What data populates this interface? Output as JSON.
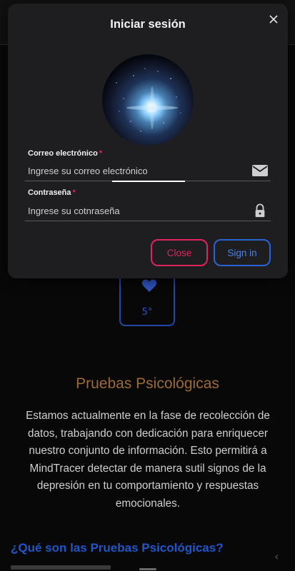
{
  "background": {
    "heart_card": {
      "value": "5°"
    },
    "section_title": "Pruebas Psicológicas",
    "section_body": "Estamos actualmente en la fase de recolección de datos, trabajando con dedicación para enriquecer nuestro conjunto de información. Esto permitirá a MindTracer detectar de manera sutil signos de la depresión en tu comportamiento y respuestas emocionales.",
    "faq_title": "¿Qué son las Pruebas Psicológicas?"
  },
  "modal": {
    "title": "Iniciar sesión",
    "email": {
      "label": "Correo electrónico",
      "required_mark": "*",
      "placeholder": "Ingrese su correo electrónico",
      "value": ""
    },
    "password": {
      "label": "Contraseña",
      "required_mark": "*",
      "placeholder": "Ingrese su cotnraseña",
      "value": ""
    },
    "buttons": {
      "close": "Close",
      "sign_in": "Sign in"
    }
  },
  "icons": {
    "close": "close-icon",
    "email": "envelope-icon",
    "password": "lock-icon",
    "heart": "heart-icon",
    "back": "chevron-left-icon"
  },
  "colors": {
    "modal_bg": "#1e1e21",
    "accent_pink": "#e0245e",
    "accent_blue": "#2a62d4",
    "section_title": "#9c6a35",
    "faq_title": "#2056c9"
  }
}
